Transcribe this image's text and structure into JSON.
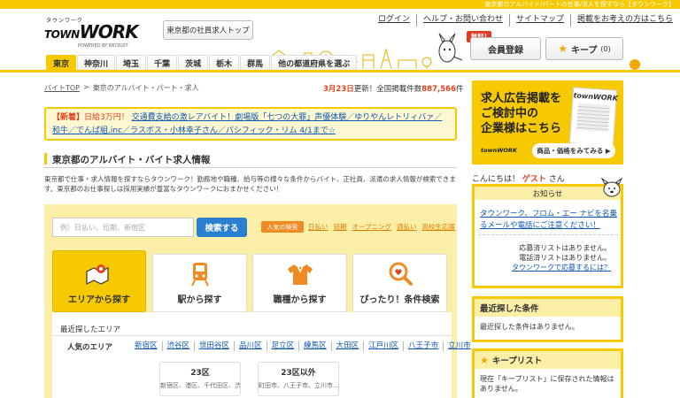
{
  "topstrip": {
    "text": "東京都のアルバイト/パートの仕事/求人を探すなら【タウンワーク】"
  },
  "header": {
    "logo_kana": "タウンワーク",
    "logo_town": "TOWN",
    "logo_work": "WORK",
    "logo_by": "POWERED BY RECRUIT",
    "toppage_label": "東京都の社員求人トップ",
    "links": [
      "ログイン",
      "ヘルプ・お問い合わせ",
      "サイトマップ",
      "掲載をお考えの方はこちら"
    ],
    "free_badge": "無料!",
    "register_label": "会員登録",
    "keep_label": "キープ",
    "keep_count": "(0)"
  },
  "prefs": {
    "tabs": [
      "東京",
      "神奈川",
      "埼玉",
      "千葉",
      "茨城",
      "栃木",
      "群馬",
      "他の都道府県を選ぶ"
    ],
    "active_index": 0
  },
  "breadcrumb": {
    "home": "バイトTOP",
    "sep": ">",
    "current": "東京のアルバイト・パート・求人"
  },
  "update": {
    "date": "3月23日",
    "mid": "更新！全国掲載件数",
    "count": "887,566",
    "unit": "件"
  },
  "news": {
    "tag": "【新着】",
    "text_1": "日給3万円！",
    "link_1": "交通費支給の激レアバイト！劇場版「七つの大罪」声優体験／ゆりやんレトリィバァ／和牛／でんぱ組.inc／ラスボス・小林幸子さん／パシフィック・リム 4/1まで☆"
  },
  "section": {
    "title": "東京都のアルバイト・バイト求人情報",
    "desc": "東京都で仕事・求人情報を探すならタウンワーク！勤務地や職種、給与等の様々な条件からバイト、正社員、派遣の求人情報が検索できます。東京都のお仕事探しは採用実績が豊富なタウンワークにおまかせください！"
  },
  "search": {
    "placeholder": "例）日払い、短期、新宿区",
    "button": "検索する",
    "popular_label": "人気の検索",
    "popular": [
      "日払い",
      "短期",
      "オープニング",
      "週払い",
      "高校生応援"
    ]
  },
  "categories": [
    {
      "label": "エリアから探す",
      "icon": "map-icon"
    },
    {
      "label": "駅から探す",
      "icon": "train-icon"
    },
    {
      "label": "職種から探す",
      "icon": "shirt-icon"
    },
    {
      "label": "ぴったり！条件検索",
      "icon": "magnifier-icon"
    }
  ],
  "area": {
    "recent": "最近探したエリア",
    "popular_label": "人気のエリア",
    "popular": [
      "新宿区",
      "渋谷区",
      "世田谷区",
      "品川区",
      "足立区",
      "練馬区",
      "大田区",
      "江戸川区",
      "八王子市",
      "立川市"
    ],
    "boxes": [
      {
        "title": "23区",
        "sub": "新宿区、港区、千代田区、渋..."
      },
      {
        "title": "23区以外",
        "sub": "町田市、八王子市、立川市..."
      }
    ]
  },
  "ad": {
    "lines": [
      "求人広告掲載を",
      "ご検討中の",
      "企業様はこちら"
    ],
    "book_logo": "townWORK",
    "logo": "townWORK",
    "button": "商品・価格をみてみる ▶"
  },
  "sidebar": {
    "hello_prefix": "こんにちは！",
    "guest": "ゲスト",
    "hello_suffix": "さん",
    "notice_title": "お知らせ",
    "notice_link": "タウンワーク、フロム・エー ナビを名乗るメールや電話にご注意ください！",
    "applied": "応募済リストはありません。",
    "called": "電話済リストはありません。",
    "apply_link": "タウンワークで応募するには？",
    "recent_title": "最近探した条件",
    "recent_text": "最近探した条件はありません。",
    "keep_title": "キープリスト",
    "keep_text": "現在「キープリスト」に保存された情報はありません。"
  },
  "colors": {
    "brand_yellow": "#f6c900",
    "link_blue": "#0b57b4",
    "accent_red": "#e0421d",
    "search_blue": "#2b7fd1"
  }
}
